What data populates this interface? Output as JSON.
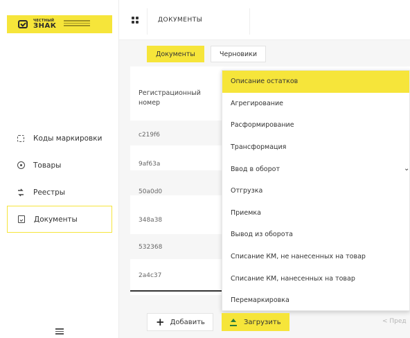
{
  "brand": {
    "logo_top": "ЧЕСТНЫЙ",
    "logo_main": "ЗНАК"
  },
  "header": {
    "page_title": "ДОКУМЕНТЫ"
  },
  "sidebar": {
    "items": [
      {
        "label": "Коды маркировки",
        "icon": "codes-icon"
      },
      {
        "label": "Товары",
        "icon": "goods-icon"
      },
      {
        "label": "Реестры",
        "icon": "registry-icon"
      },
      {
        "label": "Документы",
        "icon": "document-icon",
        "active": true
      }
    ]
  },
  "tabs": [
    {
      "label": "Документы",
      "active": true
    },
    {
      "label": "Черновики",
      "active": false
    }
  ],
  "table": {
    "header": "Регистрационный номер",
    "rows": [
      "c219f6",
      "9af63a",
      "50a0d0",
      "348a38",
      "532368",
      "2a4c37"
    ]
  },
  "dropdown": {
    "options": [
      "Описание остатков",
      "Агрегирование",
      "Расформирование",
      "Трансформация",
      "Ввод в оборот",
      "Отгрузка",
      "Приемка",
      "Вывод из оборота",
      "Списание КМ, не нанесенных на товар",
      "Списание КМ, нанесенных на товар",
      "Перемаркировка"
    ],
    "selected": "Описание остатков"
  },
  "actions": {
    "add_label": "Добавить",
    "upload_label": "Загрузить",
    "prev_label": "< Пред"
  },
  "colors": {
    "accent": "#f6e53a",
    "upload_icon": "#2b7a3a"
  }
}
